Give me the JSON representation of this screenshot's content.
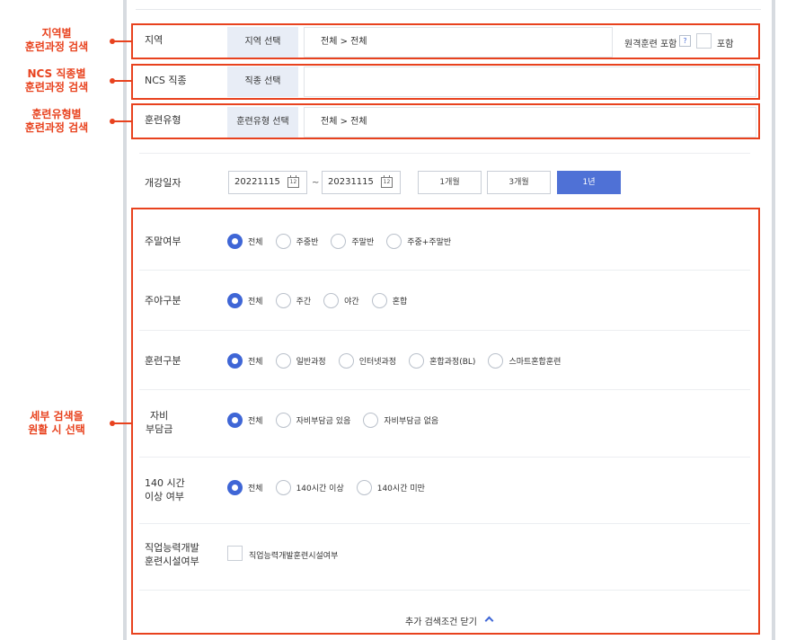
{
  "annotations": {
    "region": {
      "line1": "지역별",
      "line2": "훈련과정 검색"
    },
    "ncs": {
      "line1": "NCS 직종별",
      "line2": "훈련과정 검색"
    },
    "type": {
      "line1": "훈련유형별",
      "line2": "훈련과정 검색"
    },
    "detail": {
      "line1": "세부 검색을",
      "line2": "원활 시 선택"
    }
  },
  "region": {
    "label": "지역",
    "button": "지역 선택",
    "value": "전체 > 전체",
    "remote_label": "원격훈련 포함",
    "help": "?",
    "include_label": "포함"
  },
  "ncs": {
    "label": "NCS 직종",
    "button": "직종 선택",
    "value": ""
  },
  "training_type": {
    "label": "훈련유형",
    "button": "훈련유형 선택",
    "value": "전체 > 전체"
  },
  "open_date": {
    "label": "개강일자",
    "start": "20221115",
    "end": "20231115",
    "cal_day": "12",
    "tilde": "~",
    "periods": [
      "1개월",
      "3개월",
      "1년"
    ],
    "active_period": "1년"
  },
  "weekend": {
    "label": "주말여부",
    "options": [
      "전체",
      "주중반",
      "주말반",
      "주중+주말반"
    ],
    "selected": "전체"
  },
  "daynight": {
    "label": "주야구분",
    "options": [
      "전체",
      "주간",
      "야간",
      "혼합"
    ],
    "selected": "전체"
  },
  "training_div": {
    "label": "훈련구분",
    "options": [
      "전체",
      "일반과정",
      "인터넷과정",
      "혼합과정(BL)",
      "스마트혼합훈련"
    ],
    "selected": "전체"
  },
  "self_pay": {
    "label_line1": "자비",
    "label_line2": "부담금",
    "options": [
      "전체",
      "자비부담금 있음",
      "자비부담금 없음"
    ],
    "selected": "전체"
  },
  "hours140": {
    "label_line1": "140 시간",
    "label_line2": "이상 여부",
    "options": [
      "전체",
      "140시간 이상",
      "140시간 미만"
    ],
    "selected": "전체"
  },
  "facility": {
    "label_line1": "직업능력개발",
    "label_line2": "훈련시설여부",
    "checkbox_label": "직업능력개발훈련시설여부"
  },
  "collapse": {
    "label": "추가 검색조건 닫기"
  },
  "colors": {
    "accent": "#3f66d6",
    "highlight": "#e8421e",
    "button_bg": "#e8edf6"
  }
}
